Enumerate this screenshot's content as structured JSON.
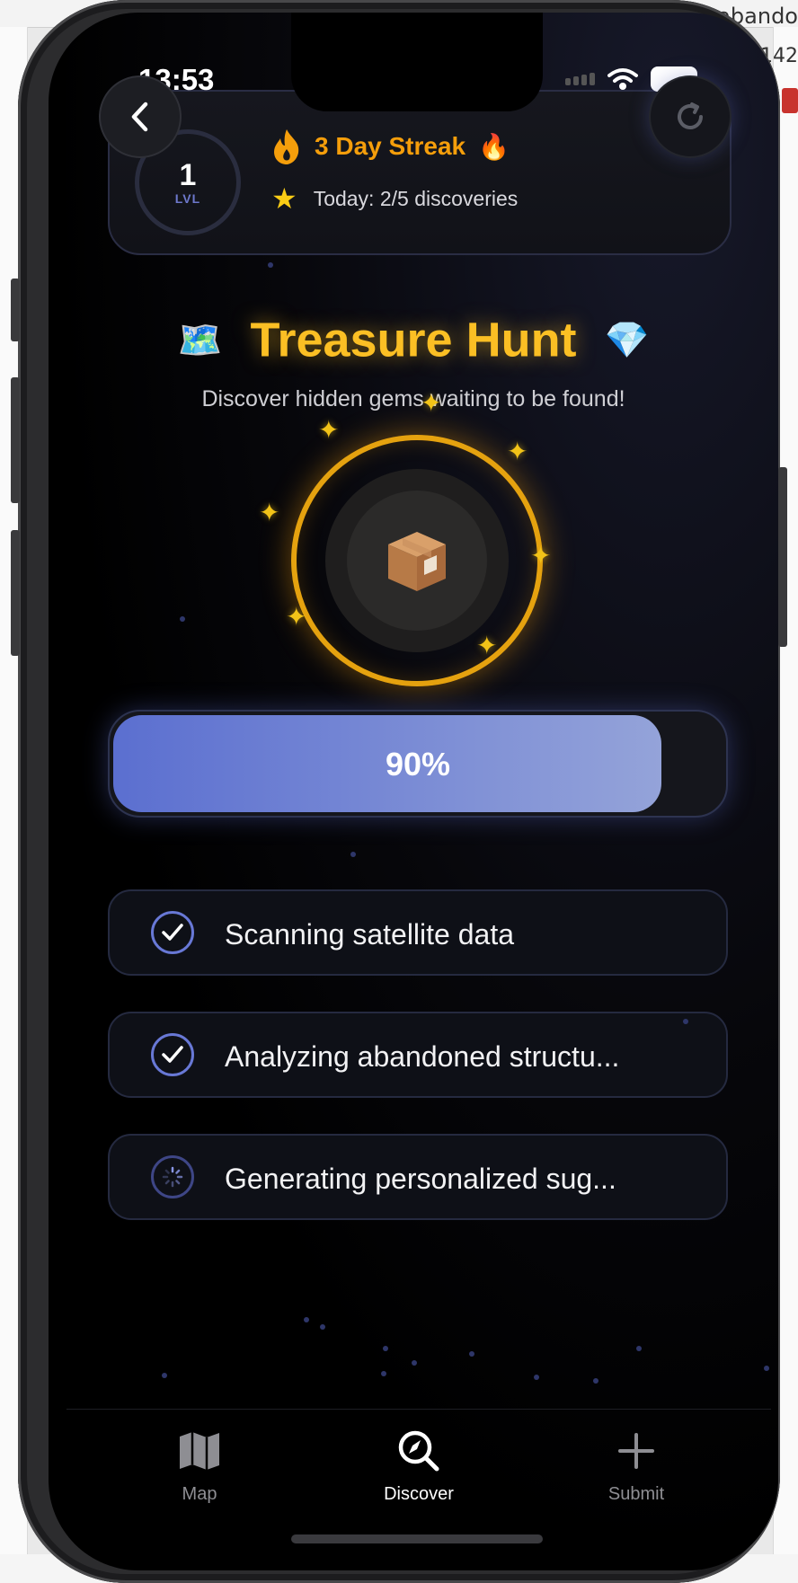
{
  "status": {
    "time": "13:53"
  },
  "header": {
    "level_number": "1",
    "level_label": "LVL",
    "streak_text": "3 Day Streak",
    "today_text": "Today: 2/5 discoveries"
  },
  "hunt": {
    "title": "Treasure Hunt",
    "subtitle": "Discover hidden gems waiting to be found!"
  },
  "progress": {
    "value_percent": 90,
    "label": "90%"
  },
  "steps": [
    {
      "label": "Scanning satellite data",
      "state": "done"
    },
    {
      "label": "Analyzing abandoned structu...",
      "state": "done"
    },
    {
      "label": "Generating personalized sug...",
      "state": "loading"
    }
  ],
  "tabs": [
    {
      "label": "Map",
      "icon": "map-icon",
      "active": false
    },
    {
      "label": "Discover",
      "icon": "discover-icon",
      "active": true
    },
    {
      "label": "Submit",
      "icon": "plus-icon",
      "active": false
    }
  ],
  "colors": {
    "accent_gold": "#fbbf24",
    "streak_orange": "#f59e0b",
    "progress_blue": "#5b6fd0",
    "check_blue": "#6878d6"
  },
  "background": {
    "corner_text": ": abando",
    "corner_number": "142"
  }
}
